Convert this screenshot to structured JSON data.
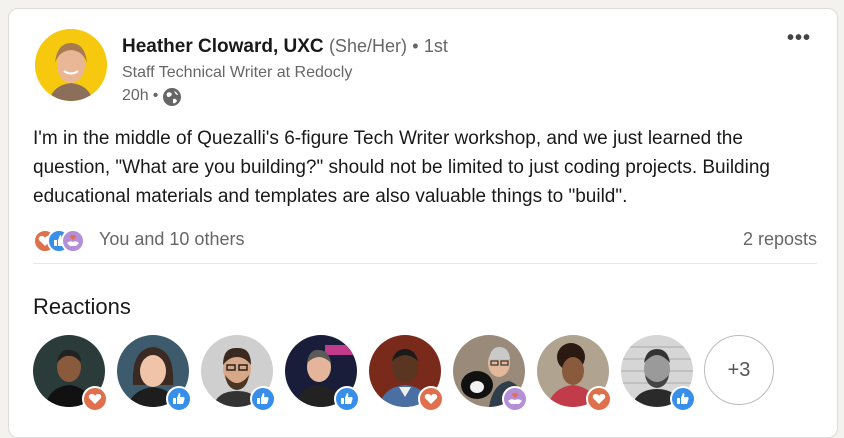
{
  "author": {
    "name": "Heather Cloward, UXC",
    "pronouns": "(She/Her)",
    "degree": "1st",
    "headline": "Staff Technical Writer at Redocly",
    "time": "20h"
  },
  "post": {
    "text": "I'm in the middle of Quezalli's 6-figure Tech Writer workshop, and we just learned the question, \"What are you building?\" should not be limited to just coding projects. Building educational materials and templates are also valuable things to \"build\"."
  },
  "social": {
    "reactors_text": "You and 10 others",
    "reposts_text": "2 reposts",
    "reaction_icons": [
      "love-icon",
      "like-icon",
      "support-icon"
    ]
  },
  "reactions_section": {
    "title": "Reactions",
    "more_label": "+3",
    "reactors": [
      {
        "badge": "love"
      },
      {
        "badge": "like"
      },
      {
        "badge": "like"
      },
      {
        "badge": "like"
      },
      {
        "badge": "love"
      },
      {
        "badge": "support"
      },
      {
        "badge": "love"
      },
      {
        "badge": "like"
      }
    ]
  },
  "colors": {
    "like": "#378fe9",
    "love": "#df704d",
    "support": "#b58ed8",
    "avatar_bg": "#f6c90e"
  }
}
